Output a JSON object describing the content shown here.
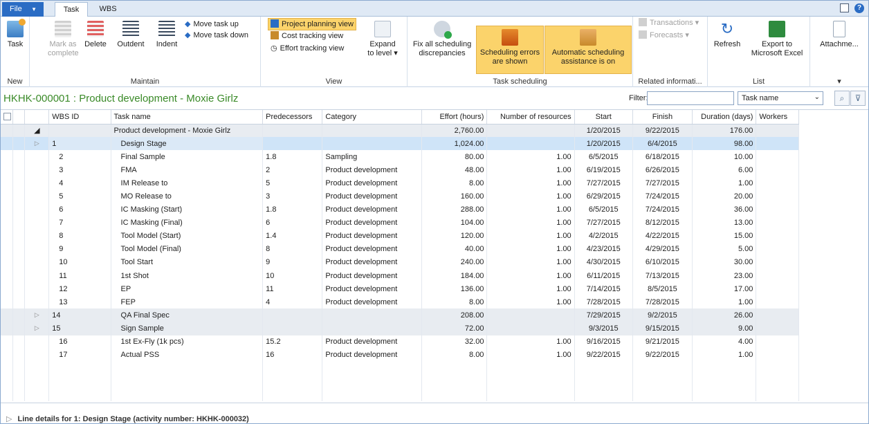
{
  "tabs": {
    "file": "File",
    "task": "Task",
    "wbs": "WBS"
  },
  "ribbon": {
    "new": {
      "task": "Task",
      "label": "New"
    },
    "maintain": {
      "mark_complete": "Mark as complete",
      "delete": "Delete",
      "outdent": "Outdent",
      "indent": "Indent",
      "move_up": "Move task up",
      "move_down": "Move task down",
      "label": "Maintain"
    },
    "view": {
      "planning": "Project planning view",
      "cost": "Cost tracking view",
      "effort": "Effort tracking view",
      "expand": "Expand to level",
      "label": "View"
    },
    "scheduling": {
      "fix": "Fix all scheduling discrepancies",
      "errors": "Scheduling errors are shown",
      "auto": "Automatic scheduling assistance is on",
      "label": "Task scheduling"
    },
    "related": {
      "transactions": "Transactions",
      "forecasts": "Forecasts",
      "label": "Related informati..."
    },
    "list": {
      "refresh": "Refresh",
      "export": "Export to Microsoft Excel",
      "label": "List"
    },
    "attach": {
      "label": "Attachme..."
    }
  },
  "page_title": "HKHK-000001 : Product development - Moxie Girlz",
  "filter": {
    "label": "Filter:",
    "value": "",
    "field": "Task name"
  },
  "columns": [
    "WBS ID",
    "Task name",
    "Predecessors",
    "Category",
    "Effort (hours)",
    "Number of resources",
    "Start",
    "Finish",
    "Duration (days)",
    "Workers"
  ],
  "root": {
    "name": "Product development - Moxie Girlz",
    "effort": "2,760.00",
    "start": "1/20/2015",
    "finish": "9/22/2015",
    "duration": "176.00"
  },
  "rows": [
    {
      "wbs": "1",
      "name": "Design Stage",
      "pred": "",
      "cat": "",
      "effort": "1,024.00",
      "res": "",
      "start": "1/20/2015",
      "finish": "6/4/2015",
      "dur": "98.00",
      "kind": "sel"
    },
    {
      "wbs": "2",
      "name": "Final Sample",
      "pred": "1.8",
      "cat": "Sampling",
      "effort": "80.00",
      "res": "1.00",
      "start": "6/5/2015",
      "finish": "6/18/2015",
      "dur": "10.00",
      "kind": ""
    },
    {
      "wbs": "3",
      "name": "FMA",
      "pred": "2",
      "cat": "Product development",
      "effort": "48.00",
      "res": "1.00",
      "start": "6/19/2015",
      "finish": "6/26/2015",
      "dur": "6.00",
      "kind": ""
    },
    {
      "wbs": "4",
      "name": "IM Release to",
      "pred": "5",
      "cat": "Product development",
      "effort": "8.00",
      "res": "1.00",
      "start": "7/27/2015",
      "finish": "7/27/2015",
      "dur": "1.00",
      "kind": ""
    },
    {
      "wbs": "5",
      "name": "MO Release to",
      "pred": "3",
      "cat": "Product development",
      "effort": "160.00",
      "res": "1.00",
      "start": "6/29/2015",
      "finish": "7/24/2015",
      "dur": "20.00",
      "kind": ""
    },
    {
      "wbs": "6",
      "name": "IC Masking (Start)",
      "pred": "1.8",
      "cat": "Product development",
      "effort": "288.00",
      "res": "1.00",
      "start": "6/5/2015",
      "finish": "7/24/2015",
      "dur": "36.00",
      "kind": ""
    },
    {
      "wbs": "7",
      "name": "IC Masking (Final)",
      "pred": "6",
      "cat": "Product development",
      "effort": "104.00",
      "res": "1.00",
      "start": "7/27/2015",
      "finish": "8/12/2015",
      "dur": "13.00",
      "kind": ""
    },
    {
      "wbs": "8",
      "name": "Tool Model (Start)",
      "pred": "1.4",
      "cat": "Product development",
      "effort": "120.00",
      "res": "1.00",
      "start": "4/2/2015",
      "finish": "4/22/2015",
      "dur": "15.00",
      "kind": ""
    },
    {
      "wbs": "9",
      "name": "Tool Model (Final)",
      "pred": "8",
      "cat": "Product development",
      "effort": "40.00",
      "res": "1.00",
      "start": "4/23/2015",
      "finish": "4/29/2015",
      "dur": "5.00",
      "kind": ""
    },
    {
      "wbs": "10",
      "name": "Tool Start",
      "pred": "9",
      "cat": "Product development",
      "effort": "240.00",
      "res": "1.00",
      "start": "4/30/2015",
      "finish": "6/10/2015",
      "dur": "30.00",
      "kind": ""
    },
    {
      "wbs": "11",
      "name": "1st Shot",
      "pred": "10",
      "cat": "Product development",
      "effort": "184.00",
      "res": "1.00",
      "start": "6/11/2015",
      "finish": "7/13/2015",
      "dur": "23.00",
      "kind": ""
    },
    {
      "wbs": "12",
      "name": "EP",
      "pred": "11",
      "cat": "Product development",
      "effort": "136.00",
      "res": "1.00",
      "start": "7/14/2015",
      "finish": "8/5/2015",
      "dur": "17.00",
      "kind": ""
    },
    {
      "wbs": "13",
      "name": "FEP",
      "pred": "4",
      "cat": "Product development",
      "effort": "8.00",
      "res": "1.00",
      "start": "7/28/2015",
      "finish": "7/28/2015",
      "dur": "1.00",
      "kind": ""
    },
    {
      "wbs": "14",
      "name": "QA Final Spec",
      "pred": "",
      "cat": "",
      "effort": "208.00",
      "res": "",
      "start": "7/29/2015",
      "finish": "9/2/2015",
      "dur": "26.00",
      "kind": "grp"
    },
    {
      "wbs": "15",
      "name": "Sign Sample",
      "pred": "",
      "cat": "",
      "effort": "72.00",
      "res": "",
      "start": "9/3/2015",
      "finish": "9/15/2015",
      "dur": "9.00",
      "kind": "grp"
    },
    {
      "wbs": "16",
      "name": "1st Ex-Fly (1k pcs)",
      "pred": "15.2",
      "cat": "Product development",
      "effort": "32.00",
      "res": "1.00",
      "start": "9/16/2015",
      "finish": "9/21/2015",
      "dur": "4.00",
      "kind": ""
    },
    {
      "wbs": "17",
      "name": "Actual PSS",
      "pred": "16",
      "cat": "Product development",
      "effort": "8.00",
      "res": "1.00",
      "start": "9/22/2015",
      "finish": "9/22/2015",
      "dur": "1.00",
      "kind": ""
    }
  ],
  "footer": "Line details for 1: Design Stage (activity number: HKHK-000032)"
}
